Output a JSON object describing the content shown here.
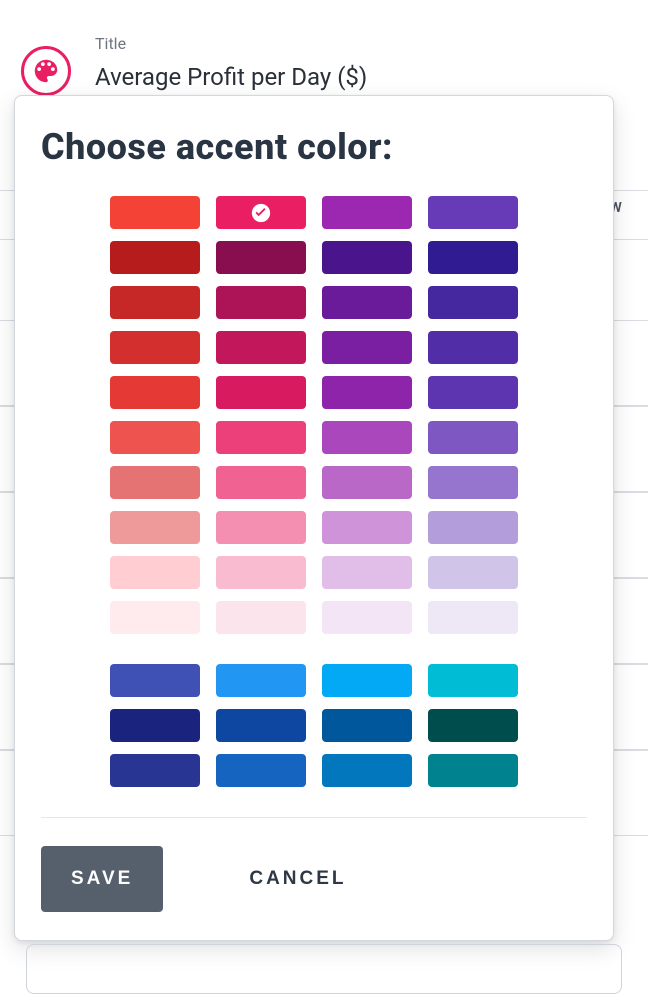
{
  "page": {
    "title_label": "Title",
    "title_value": "Average Profit per Day ($)",
    "bg_label_fragment": ". W"
  },
  "dialog": {
    "title": "Choose accent color:",
    "save_label": "SAVE",
    "cancel_label": "CANCEL",
    "sections": [
      {
        "name": "reds-purples",
        "count": 40,
        "cols": 4,
        "selected_index": 1,
        "colors": [
          "#f44336",
          "#e91e63",
          "#9c27b0",
          "#673ab7",
          "#b71c1c",
          "#880e4f",
          "#4a148c",
          "#311b92",
          "#c62828",
          "#ad1457",
          "#6a1b9a",
          "#4527a0",
          "#d32f2f",
          "#c2185b",
          "#7b1fa2",
          "#512da8",
          "#e53935",
          "#d81b60",
          "#8e24aa",
          "#5e35b1",
          "#ef5350",
          "#ec407a",
          "#ab47bc",
          "#7e57c2",
          "#e57373",
          "#f06292",
          "#ba68c8",
          "#9575cd",
          "#ef9a9a",
          "#f48fb1",
          "#ce93d8",
          "#b39ddb",
          "#ffcdd2",
          "#f8bbd0",
          "#e1bee7",
          "#d1c4e9",
          "#ffebee",
          "#fce4ec",
          "#f3e5f5",
          "#ede7f6"
        ]
      },
      {
        "name": "blues-teals",
        "count": 12,
        "cols": 4,
        "selected_index": -1,
        "colors": [
          "#3f51b5",
          "#2196f3",
          "#03a9f4",
          "#00bcd4",
          "#1a237e",
          "#0d47a1",
          "#01579b",
          "#004d4d",
          "#283593",
          "#1565c0",
          "#0277bd",
          "#00838f"
        ]
      }
    ]
  }
}
